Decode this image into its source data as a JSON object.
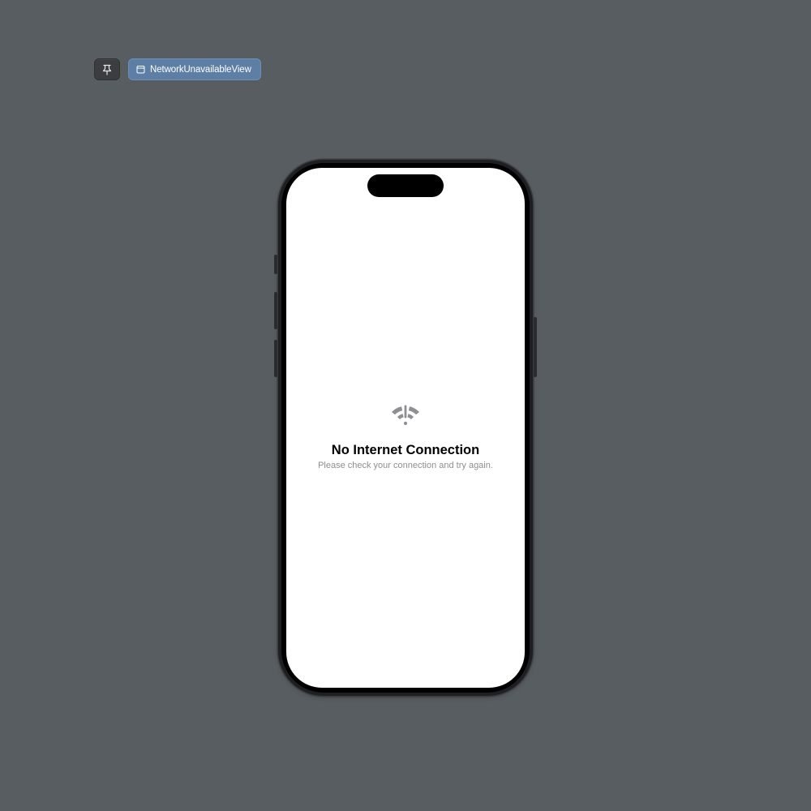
{
  "toolbar": {
    "pin_icon": "pin-icon",
    "preview_name": "NetworkUnavailableView",
    "preview_icon": "view-icon"
  },
  "device": {
    "model": "iPhone",
    "screen_background": "#ffffff"
  },
  "screen": {
    "icon": "wifi-exclamationmark-icon",
    "title": "No Internet Connection",
    "message": "Please check your connection and try again."
  },
  "colors": {
    "canvas_background": "#585d62",
    "chip_accent": "#5d7fa6",
    "icon_gray": "#8e8e93",
    "subtitle_gray": "#8e8e93"
  }
}
